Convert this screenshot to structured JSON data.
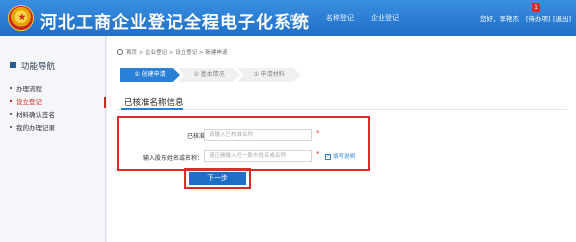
{
  "header": {
    "title": "河北工商企业登记全程电子化系统",
    "nav": [
      "首页",
      "名称登记",
      "企业登记"
    ],
    "greeting": "您好，李艳杰",
    "todo_label": "[待办项]",
    "todo_count": "1",
    "logout_label": "[退出]"
  },
  "sidebar": {
    "heading": "功能导航",
    "items": [
      {
        "label": "办理流程",
        "active": false
      },
      {
        "label": "设立登记",
        "active": true
      },
      {
        "label": "材料确认签名",
        "active": false
      },
      {
        "label": "我的办理记录",
        "active": false
      }
    ]
  },
  "main": {
    "breadcrumb": "首页 > 企业登记 > 设立登记 > 新建申请",
    "steps": [
      "① 创建申请",
      "② 基本情况",
      "③ 申请材料"
    ],
    "tab_title": "已核准名称信息",
    "form": {
      "approved_name_label": "已核准名称：",
      "approved_name_placeholder": "请输入已核准名称",
      "notice_no_label": "输入股东姓名或名称：",
      "notice_no_placeholder": "请正确输入任一股东姓名或名称",
      "help_label": "填写说明",
      "required_mark": "*"
    },
    "next_button": "下一步"
  },
  "colors": {
    "header_blue": "#1f6fc9",
    "accent_red": "#e02a2a",
    "active_red": "#c8281e"
  }
}
